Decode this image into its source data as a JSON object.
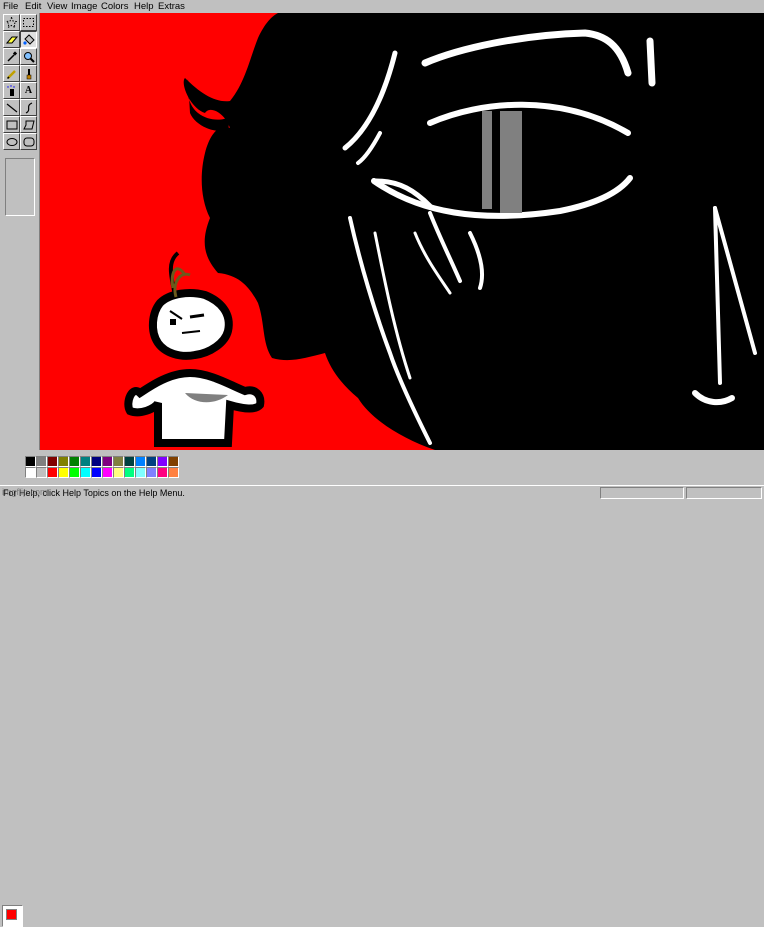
{
  "menubar": {
    "items": [
      "File",
      "Edit",
      "View",
      "Image",
      "Colors",
      "Help",
      "Extras"
    ]
  },
  "toolbox": {
    "tools": [
      {
        "name": "free-form-select-tool",
        "icon": "star-select-icon"
      },
      {
        "name": "rect-select-tool",
        "icon": "dashed-rect-icon"
      },
      {
        "name": "eraser-tool",
        "icon": "eraser-icon"
      },
      {
        "name": "fill-tool",
        "icon": "paint-bucket-icon",
        "selected": true
      },
      {
        "name": "pick-color-tool",
        "icon": "eyedropper-icon"
      },
      {
        "name": "magnifier-tool",
        "icon": "magnifier-icon"
      },
      {
        "name": "pencil-tool",
        "icon": "pencil-icon"
      },
      {
        "name": "brush-tool",
        "icon": "brush-icon"
      },
      {
        "name": "airbrush-tool",
        "icon": "airbrush-icon"
      },
      {
        "name": "text-tool",
        "icon": "text-a-icon",
        "glyph": "A"
      },
      {
        "name": "line-tool",
        "icon": "line-icon"
      },
      {
        "name": "curve-tool",
        "icon": "curve-icon"
      },
      {
        "name": "rectangle-tool",
        "icon": "rectangle-icon"
      },
      {
        "name": "polygon-tool",
        "icon": "polygon-icon"
      },
      {
        "name": "ellipse-tool",
        "icon": "ellipse-icon"
      },
      {
        "name": "rounded-rect-tool",
        "icon": "rounded-rect-icon"
      }
    ]
  },
  "colors": {
    "foreground": "#ff0000",
    "background": "#ffffff",
    "canvas_red": "#ff0000",
    "canvas_black": "#000000",
    "palette_top": [
      "#000000",
      "#808080",
      "#800000",
      "#808000",
      "#008000",
      "#008080",
      "#000080",
      "#800080",
      "#808040",
      "#004040",
      "#0080ff",
      "#004080",
      "#8000ff",
      "#804000"
    ],
    "palette_bottom": [
      "#ffffff",
      "#c0c0c0",
      "#ff0000",
      "#ffff00",
      "#00ff00",
      "#00ffff",
      "#0000ff",
      "#ff00ff",
      "#ffff80",
      "#00ff80",
      "#80ffff",
      "#8080ff",
      "#ff0080",
      "#ff8040"
    ]
  },
  "status": {
    "text": "For Help, click Help Topics on the Help Menu.",
    "watermark": "imgflip.com"
  }
}
